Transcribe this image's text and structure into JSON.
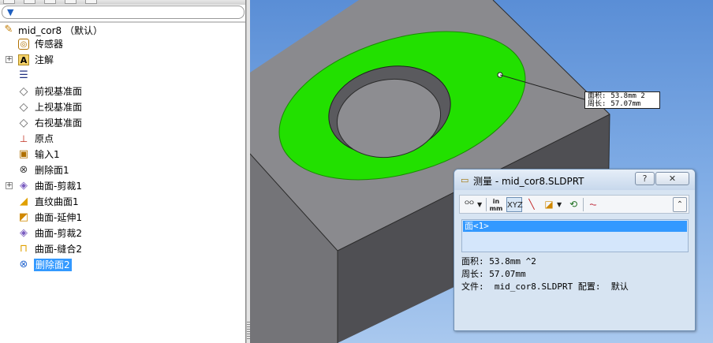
{
  "feature_tree": {
    "filter_icon": "filter-icon",
    "root_label": "mid_cor8 （默认）",
    "items": [
      {
        "label": "传感器",
        "icon": "sensor-icon",
        "expandable": false
      },
      {
        "label": "注解",
        "icon": "annotation-icon",
        "expandable": true
      },
      {
        "label": "",
        "icon": "material-icon",
        "expandable": false
      },
      {
        "label": "前视基准面",
        "icon": "plane-icon",
        "expandable": false
      },
      {
        "label": "上视基准面",
        "icon": "plane-icon",
        "expandable": false
      },
      {
        "label": "右视基准面",
        "icon": "plane-icon",
        "expandable": false
      },
      {
        "label": "原点",
        "icon": "origin-icon",
        "expandable": false
      },
      {
        "label": "输入1",
        "icon": "import-icon",
        "expandable": false
      },
      {
        "label": "删除面1",
        "icon": "delete-face-icon",
        "expandable": false
      },
      {
        "label": "曲面-剪裁1",
        "icon": "surface-trim-icon",
        "expandable": true
      },
      {
        "label": "直纹曲面1",
        "icon": "ruled-surface-icon",
        "expandable": false
      },
      {
        "label": "曲面-延伸1",
        "icon": "surface-extend-icon",
        "expandable": false
      },
      {
        "label": "曲面-剪裁2",
        "icon": "surface-trim-icon",
        "expandable": false
      },
      {
        "label": "曲面-缝合2",
        "icon": "surface-knit-icon",
        "expandable": false
      },
      {
        "label": "删除面2",
        "icon": "delete-face-icon",
        "expandable": false,
        "selected": true
      }
    ]
  },
  "callout": {
    "area_label": "面积:",
    "area_value": "53.8mm 2",
    "perimeter_label": "周长:",
    "perimeter_value": "57.07mm"
  },
  "measure_dialog": {
    "title": "测量 - mid_cor8.SLDPRT",
    "help_label": "?",
    "close_label": "✕",
    "toolbar": {
      "units_top": "in",
      "units_bottom": "mm"
    },
    "selection": "面<1>",
    "results": {
      "area": "面积: 53.8mm ^2",
      "perimeter": "周长: 57.07mm",
      "file": "文件:  mid_cor8.SLDPRT 配置:  默认"
    }
  },
  "colors": {
    "selected_face": "#22e000",
    "model_top": "#8a8a8e",
    "model_front": "#767679",
    "model_side": "#4e4e52",
    "viewport_top": "#5a8ed6",
    "selection_highlight": "#3399ff"
  }
}
